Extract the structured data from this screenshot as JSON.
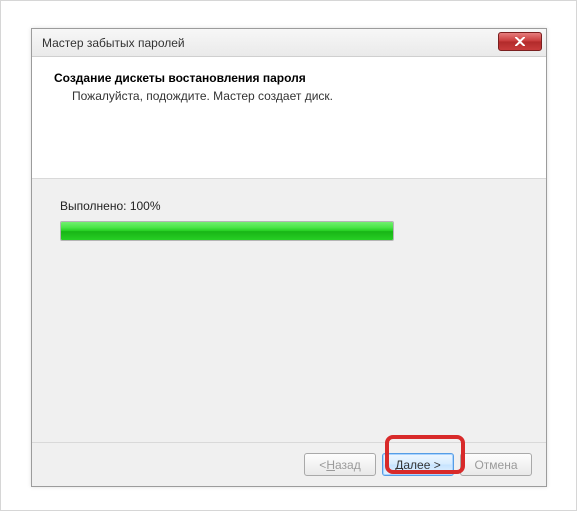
{
  "window": {
    "title": "Мастер забытых паролей"
  },
  "header": {
    "heading": "Создание дискеты востановления пароля",
    "subheading": "Пожалуйста, подождите. Мастер создает диск."
  },
  "progress": {
    "label_prefix": "Выполнено: ",
    "percent_text": "100%",
    "percent_value": 100
  },
  "buttons": {
    "back_prefix": "< ",
    "back_hotkey": "Н",
    "back_rest": "азад",
    "next_hotkey": "Д",
    "next_rest": "алее >",
    "cancel": "Отмена"
  }
}
